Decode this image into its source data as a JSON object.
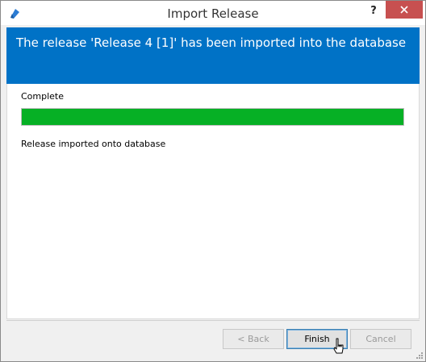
{
  "window": {
    "title": "Import Release",
    "help_label": "?",
    "icon": "app-logo-icon"
  },
  "banner": {
    "message": "The release 'Release 4 [1]' has been imported into the database",
    "color": "#0072c6"
  },
  "status": {
    "label": "Complete",
    "progress": 1.0,
    "progress_color": "#06b025",
    "result": "Release imported onto database"
  },
  "buttons": {
    "back": "< Back",
    "finish": "Finish",
    "cancel": "Cancel"
  }
}
